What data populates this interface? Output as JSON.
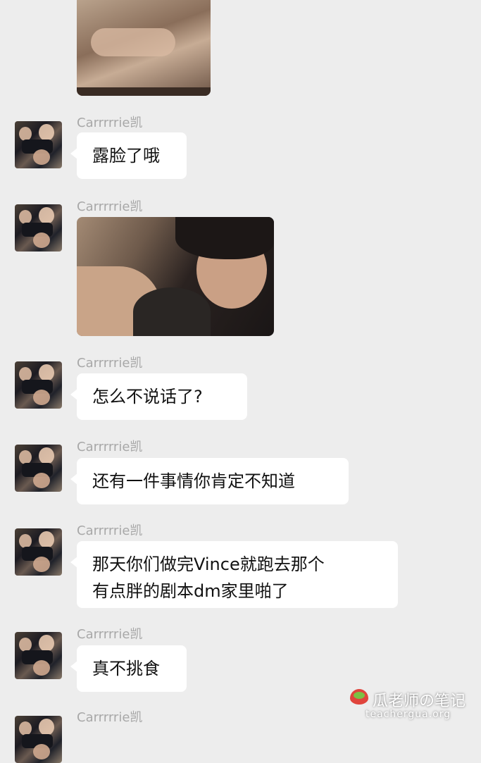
{
  "chat": {
    "sender": "Carrrrrie凯",
    "messages": [
      {
        "type": "image",
        "description_icon": "photo"
      },
      {
        "type": "text",
        "text": "露脸了哦"
      },
      {
        "type": "image",
        "description_icon": "photo"
      },
      {
        "type": "text",
        "text": "怎么不说话了?"
      },
      {
        "type": "text",
        "text": "还有一件事情你肯定不知道"
      },
      {
        "type": "text",
        "text": "那天你们做完Vince就跑去那个\n有点胖的剧本dm家里啪了"
      },
      {
        "type": "text",
        "text": "真不挑食"
      }
    ]
  },
  "watermark": {
    "title": "瓜老师の笔记",
    "url": "teachergua.org"
  },
  "colors": {
    "background": "#ededed",
    "bubble": "#ffffff",
    "sender_name": "#a8a8a8"
  }
}
